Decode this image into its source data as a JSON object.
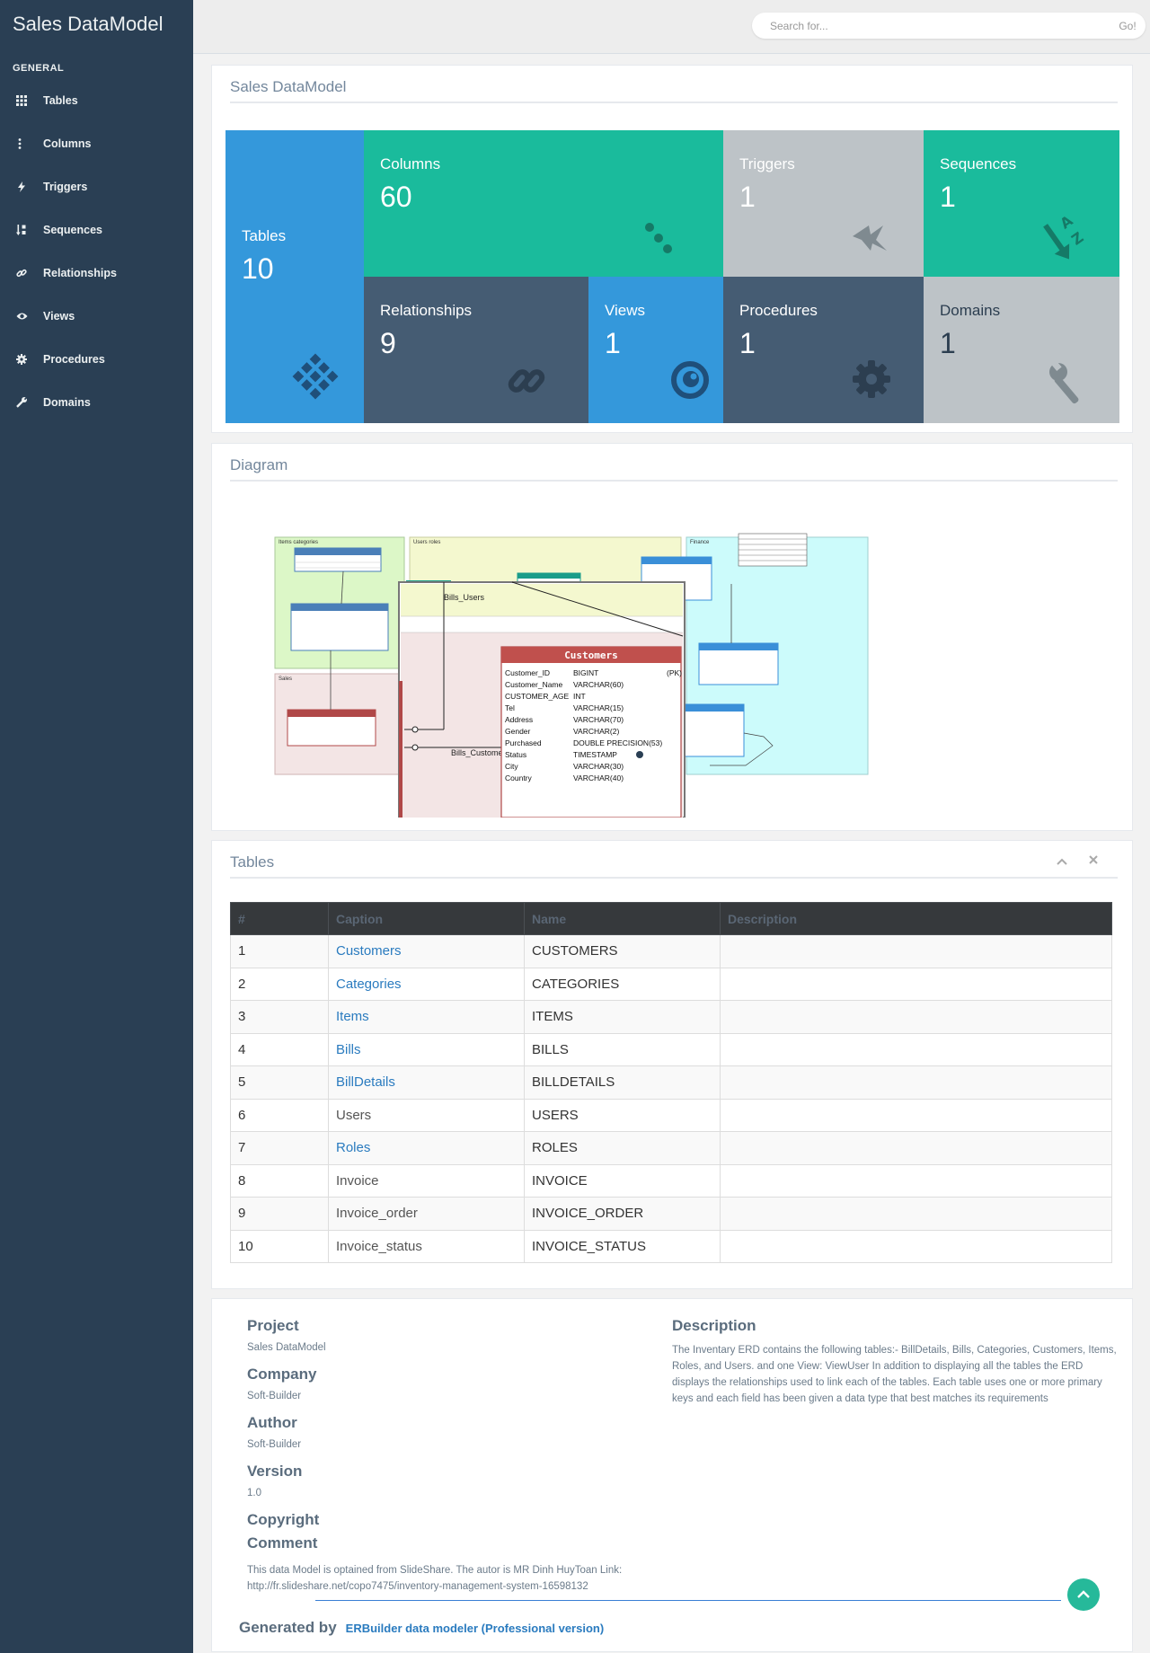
{
  "app": {
    "title": "Sales DataModel"
  },
  "sidebar": {
    "section": "GENERAL",
    "items": [
      {
        "label": "Tables",
        "icon": "table-grid-icon"
      },
      {
        "label": "Columns",
        "icon": "columns-dots-icon"
      },
      {
        "label": "Triggers",
        "icon": "bolt-icon"
      },
      {
        "label": "Sequences",
        "icon": "sort-az-icon"
      },
      {
        "label": "Relationships",
        "icon": "link-icon"
      },
      {
        "label": "Views",
        "icon": "eye-icon"
      },
      {
        "label": "Procedures",
        "icon": "gear-icon"
      },
      {
        "label": "Domains",
        "icon": "wrench-icon"
      }
    ]
  },
  "search": {
    "placeholder": "Search for...",
    "go": "Go!"
  },
  "summary": {
    "title": "Sales DataModel",
    "tiles": {
      "tables": {
        "label": "Tables",
        "value": "10",
        "color": "#3498db"
      },
      "columns": {
        "label": "Columns",
        "value": "60",
        "color": "#1abb9c"
      },
      "triggers": {
        "label": "Triggers",
        "value": "1",
        "color": "#bdc3c7"
      },
      "sequences": {
        "label": "Sequences",
        "value": "1",
        "color": "#1abb9c"
      },
      "relationships": {
        "label": "Relationships",
        "value": "9",
        "color": "#455c73"
      },
      "views": {
        "label": "Views",
        "value": "1",
        "color": "#3498db"
      },
      "procedures": {
        "label": "Procedures",
        "value": "1",
        "color": "#455c73"
      },
      "domains": {
        "label": "Domains",
        "value": "1",
        "color": "#bdc3c7"
      }
    }
  },
  "diagram": {
    "title": "Diagram",
    "groups": [
      "Items categories",
      "Users roles",
      "Finance",
      "Sales"
    ],
    "link_labels": [
      "Bills_Users",
      "Bills_Customers"
    ],
    "customers": {
      "name": "Customers",
      "columns": [
        {
          "name": "Customer_ID",
          "type": "BIGINT",
          "key": "(PK)"
        },
        {
          "name": "Customer_Name",
          "type": "VARCHAR(60)",
          "key": ""
        },
        {
          "name": "CUSTOMER_AGE",
          "type": "INT",
          "key": ""
        },
        {
          "name": "Tel",
          "type": "VARCHAR(15)",
          "key": ""
        },
        {
          "name": "Address",
          "type": "VARCHAR(70)",
          "key": ""
        },
        {
          "name": "Gender",
          "type": "VARCHAR(2)",
          "key": ""
        },
        {
          "name": "Purchased",
          "type": "DOUBLE PRECISION(53)",
          "key": ""
        },
        {
          "name": "Status",
          "type": "TIMESTAMP",
          "key": ""
        },
        {
          "name": "City",
          "type": "VARCHAR(30)",
          "key": ""
        },
        {
          "name": "Country",
          "type": "VARCHAR(40)",
          "key": ""
        }
      ]
    }
  },
  "tables_panel": {
    "title": "Tables",
    "headers": [
      "#",
      "Caption",
      "Name",
      "Description"
    ],
    "rows": [
      {
        "num": "1",
        "caption": "Customers",
        "name": "CUSTOMERS",
        "description": "",
        "link": true
      },
      {
        "num": "2",
        "caption": "Categories",
        "name": "CATEGORIES",
        "description": "",
        "link": true
      },
      {
        "num": "3",
        "caption": "Items",
        "name": "ITEMS",
        "description": "",
        "link": true
      },
      {
        "num": "4",
        "caption": "Bills",
        "name": "BILLS",
        "description": "",
        "link": true
      },
      {
        "num": "5",
        "caption": "BillDetails",
        "name": "BILLDETAILS",
        "description": "",
        "link": true
      },
      {
        "num": "6",
        "caption": "Users",
        "name": "USERS",
        "description": "",
        "link": false
      },
      {
        "num": "7",
        "caption": "Roles",
        "name": "ROLES",
        "description": "",
        "link": true
      },
      {
        "num": "8",
        "caption": "Invoice",
        "name": "INVOICE",
        "description": "",
        "link": false
      },
      {
        "num": "9",
        "caption": "Invoice_order",
        "name": "INVOICE_ORDER",
        "description": "",
        "link": false
      },
      {
        "num": "10",
        "caption": "Invoice_status",
        "name": "INVOICE_STATUS",
        "description": "",
        "link": false
      }
    ]
  },
  "info": {
    "project_label": "Project",
    "project": "Sales DataModel",
    "company_label": "Company",
    "company": "Soft-Builder",
    "author_label": "Author",
    "author": "Soft-Builder",
    "version_label": "Version",
    "version": "1.0",
    "copyright_label": "Copyright",
    "comment_label": "Comment",
    "comment": "This data Model is optained from SlideShare. The autor is MR Dinh HuyToan Link: http://fr.slideshare.net/copo7475/inventory-management-system-16598132",
    "description_label": "Description",
    "description": "The Inventary ERD contains the following tables:- BillDetails, Bills, Categories, Customers, Items, Roles, and Users. and one View: ViewUser In addition to displaying all the tables the ERD displays the relationships used to link each of the tables. Each table uses one or more primary keys and each field has been given a data type that best matches its requirements",
    "generated_label": "Generated by",
    "generated_link": "ERBuilder data modeler (Professional version)"
  }
}
